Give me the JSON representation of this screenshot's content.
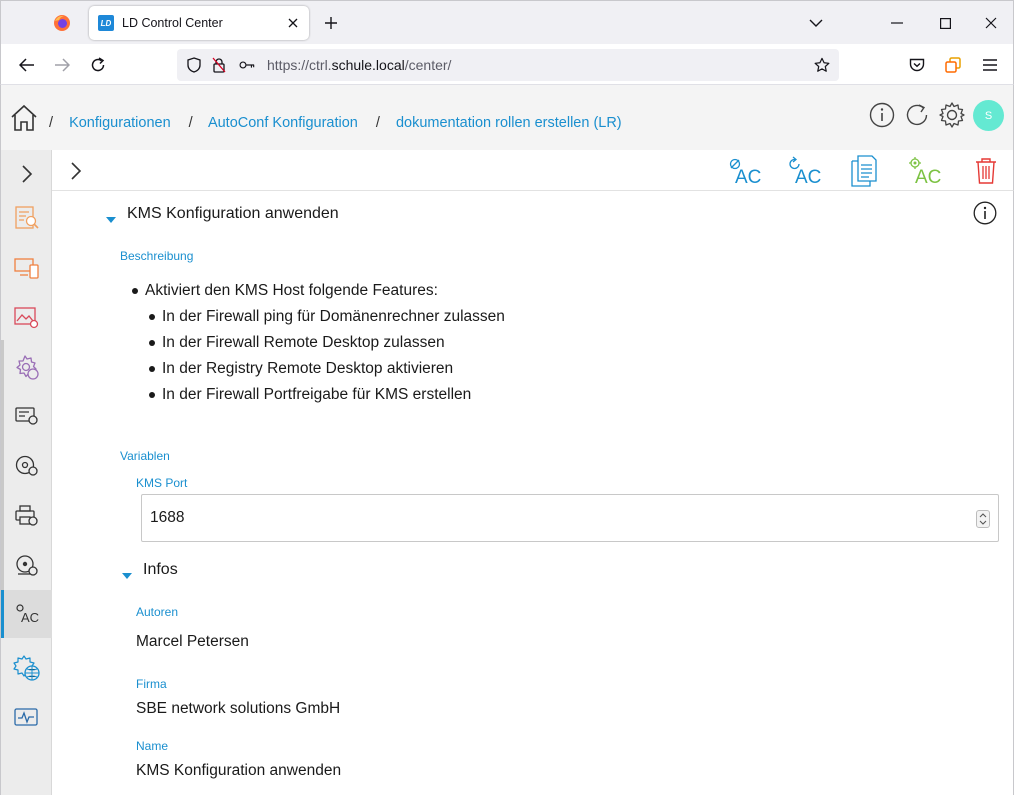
{
  "browser": {
    "tab_title": "LD Control Center",
    "tab_favicon_text": "LD",
    "url_prefix": "https://ctrl.",
    "url_host": "schule.local",
    "url_path": "/center/"
  },
  "header": {
    "breadcrumbs": [
      {
        "label": "Konfigurationen"
      },
      {
        "label": "AutoConf Konfiguration"
      },
      {
        "label": "dokumentation rollen erstellen (LR)"
      }
    ],
    "avatar_initial": "S"
  },
  "sidebar": {
    "items": [
      {
        "icon": "expand-chevron-icon"
      },
      {
        "icon": "report-icon"
      },
      {
        "icon": "devices-icon"
      },
      {
        "icon": "image-settings-icon"
      },
      {
        "icon": "configuration-gear-icon"
      },
      {
        "icon": "hardware-settings-icon"
      },
      {
        "icon": "disk-settings-icon"
      },
      {
        "icon": "printer-settings-icon"
      },
      {
        "icon": "drive-settings-icon"
      },
      {
        "icon": "autoconf-icon",
        "label": "AC",
        "active": true
      },
      {
        "icon": "network-settings-icon"
      },
      {
        "icon": "monitor-icon"
      }
    ]
  },
  "toolbar": {
    "ac_label": "AC",
    "icons": [
      "ac-disable-icon",
      "ac-reload-icon",
      "document-copy-icon",
      "ac-settings-icon",
      "delete-icon"
    ]
  },
  "content": {
    "section_title": "KMS Konfiguration anwenden",
    "description_label": "Beschreibung",
    "description": {
      "item": "Aktiviert den KMS Host folgende Features:",
      "subitems": [
        "In der Firewall ping für Domänenrechner zulassen",
        "In der Firewall Remote Desktop zulassen",
        "In der Registry Remote Desktop aktivieren",
        "In der Firewall Portfreigabe für KMS erstellen"
      ]
    },
    "variables_label": "Variablen",
    "kms_port_label": "KMS Port",
    "kms_port_value": "1688",
    "infos_title": "Infos",
    "infos": {
      "authors_label": "Autoren",
      "authors_value": "Marcel Petersen",
      "company_label": "Firma",
      "company_value": "SBE network solutions GmbH",
      "name_label": "Name",
      "name_value": "KMS Konfiguration anwenden"
    }
  },
  "colors": {
    "accent": "#1a8fcf",
    "ac_green": "#7cc243",
    "delete_red": "#e53935",
    "avatar": "#64e9d2"
  }
}
